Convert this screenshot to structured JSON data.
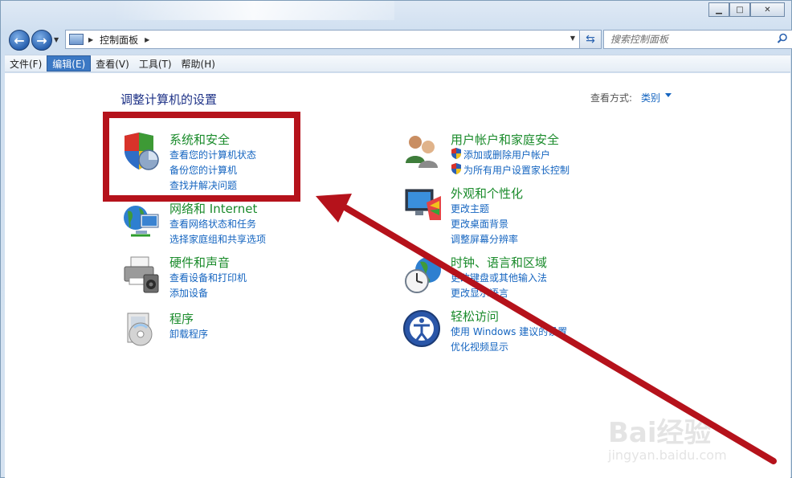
{
  "window": {
    "caption_buttons": [
      "minimize",
      "maximize",
      "close"
    ]
  },
  "nav": {
    "breadcrumb": "控制面板",
    "search_placeholder": "搜索控制面板"
  },
  "menu": {
    "items": [
      {
        "label": "文件(F)",
        "active": false
      },
      {
        "label": "编辑(E)",
        "active": true
      },
      {
        "label": "查看(V)",
        "active": false
      },
      {
        "label": "工具(T)",
        "active": false
      },
      {
        "label": "帮助(H)",
        "active": false
      }
    ]
  },
  "content": {
    "page_title": "调整计算机的设置",
    "view_by_label": "查看方式:",
    "view_by_value": "类别"
  },
  "categories": [
    {
      "title": "系统和安全",
      "icon": "shield-icon",
      "links": [
        "查看您的计算机状态",
        "备份您的计算机",
        "查找并解决问题"
      ]
    },
    {
      "title": "网络和 Internet",
      "icon": "network-icon",
      "links": [
        "查看网络状态和任务",
        "选择家庭组和共享选项"
      ]
    },
    {
      "title": "硬件和声音",
      "icon": "printer-icon",
      "links": [
        "查看设备和打印机",
        "添加设备"
      ]
    },
    {
      "title": "程序",
      "icon": "programs-icon",
      "links": [
        "卸载程序"
      ]
    },
    {
      "title": "用户帐户和家庭安全",
      "icon": "users-icon",
      "links": [
        "添加或删除用户帐户",
        "为所有用户设置家长控制"
      ]
    },
    {
      "title": "外观和个性化",
      "icon": "monitor-icon",
      "links": [
        "更改主题",
        "更改桌面背景",
        "调整屏幕分辨率"
      ]
    },
    {
      "title": "时钟、语言和区域",
      "icon": "clock-globe-icon",
      "links": [
        "更改键盘或其他输入法",
        "更改显示语言"
      ]
    },
    {
      "title": "轻松访问",
      "icon": "ease-of-access-icon",
      "links": [
        "使用 Windows 建议的设置",
        "优化视频显示"
      ]
    }
  ],
  "annotation": {
    "color": "#b5121b"
  },
  "watermark": {
    "text": "Bai经验",
    "sub": "jingyan.baidu.com"
  }
}
